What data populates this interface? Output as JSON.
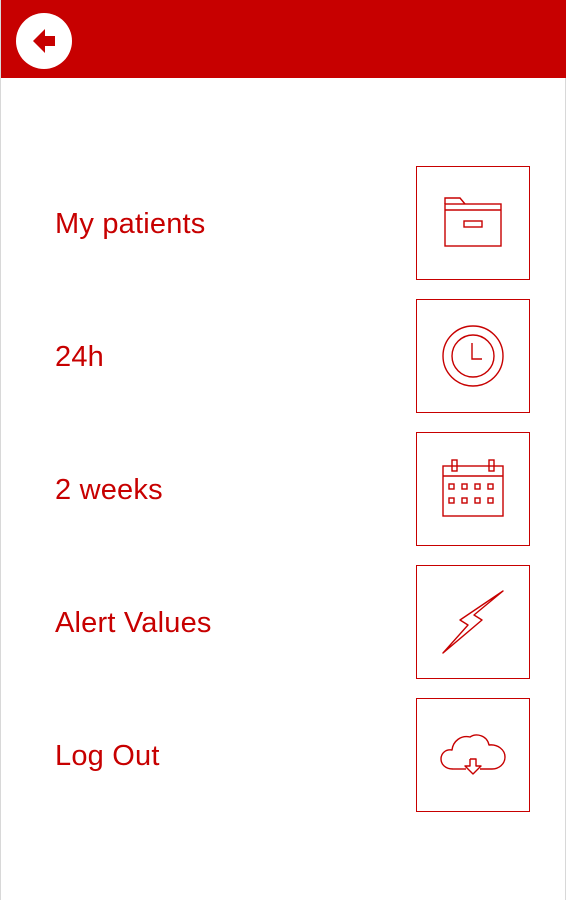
{
  "colors": {
    "accent": "#c70000",
    "background": "#ffffff"
  },
  "header": {
    "back_icon": "arrow-left-icon"
  },
  "menu": {
    "items": [
      {
        "label": "My patients",
        "icon": "folder-icon"
      },
      {
        "label": "24h",
        "icon": "clock-icon"
      },
      {
        "label": "2 weeks",
        "icon": "calendar-icon"
      },
      {
        "label": "Alert Values",
        "icon": "lightning-icon"
      },
      {
        "label": "Log Out",
        "icon": "cloud-download-icon"
      }
    ]
  }
}
